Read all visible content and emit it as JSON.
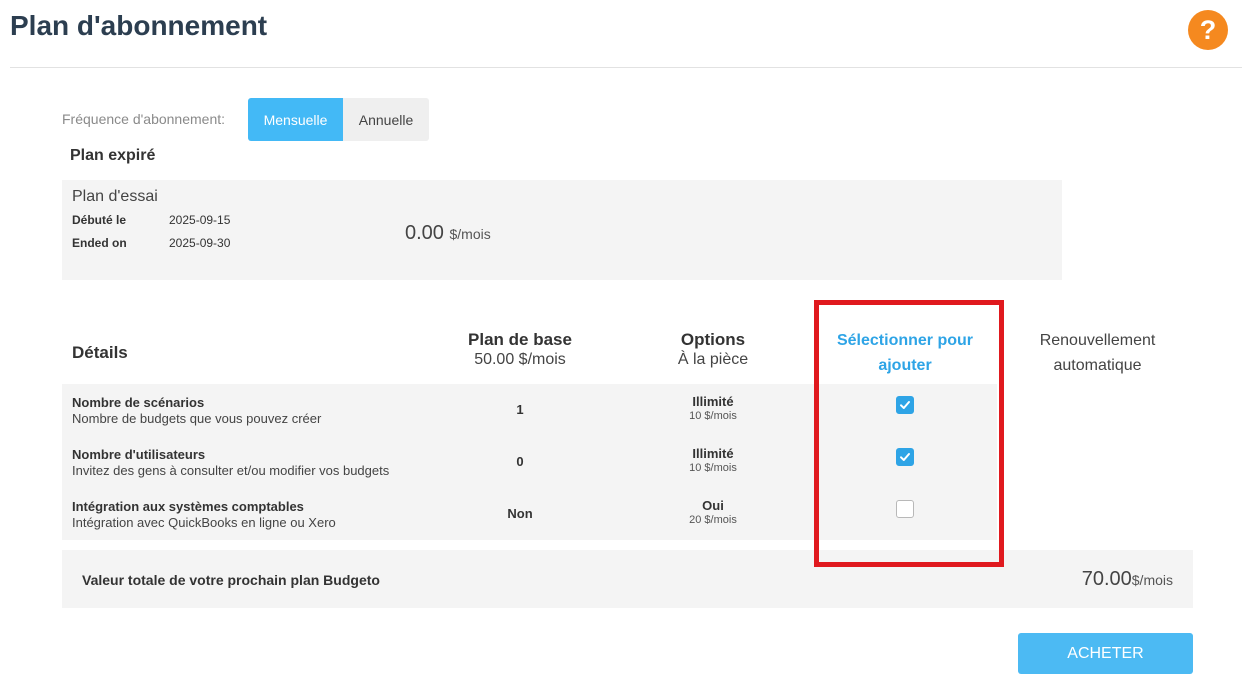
{
  "header": {
    "title": "Plan d'abonnement",
    "help_icon": "question-circle-icon",
    "help_color": "#f5891f"
  },
  "frequency": {
    "label": "Fréquence d'abonnement:",
    "options": [
      "Mensuelle",
      "Annuelle"
    ],
    "selected": "Mensuelle"
  },
  "expired_plan": {
    "heading": "Plan expiré",
    "name": "Plan d'essai",
    "started_label": "Débuté le",
    "started_value": "2025-09-15",
    "ended_label": "Ended on",
    "ended_value": "2025-09-30",
    "price": "0.00",
    "price_unit": "$/mois"
  },
  "table": {
    "details_label": "Détails",
    "base_plan_label": "Plan de base",
    "base_plan_price": "50.00 $/mois",
    "options_label": "Options",
    "options_sub": "À la pièce",
    "select_line1": "Sélectionner pour",
    "select_line2": "ajouter",
    "renew_line1": "Renouvellement",
    "renew_line2": "automatique",
    "rows": [
      {
        "name": "Nombre de scénarios",
        "description": "Nombre de budgets que vous pouvez créer",
        "base": "1",
        "option": "Illimité",
        "option_price": "10 $/mois",
        "selected": true
      },
      {
        "name": "Nombre d'utilisateurs",
        "description": "Invitez des gens à consulter et/ou modifier vos budgets",
        "base": "0",
        "option": "Illimité",
        "option_price": "10 $/mois",
        "selected": true
      },
      {
        "name": "Intégration aux systèmes comptables",
        "description": "Intégration avec QuickBooks en ligne ou Xero",
        "base": "Non",
        "option": "Oui",
        "option_price": "20 $/mois",
        "selected": false
      }
    ]
  },
  "total": {
    "label": "Valeur totale de votre prochain plan Budgeto",
    "amount": "70.00",
    "unit": "$/mois"
  },
  "buy_button": "ACHETER",
  "colors": {
    "accent_blue": "#43b9f6",
    "check_blue": "#2ea4e6",
    "highlight_red": "#e0191e",
    "panel_gray": "#f4f4f4"
  }
}
